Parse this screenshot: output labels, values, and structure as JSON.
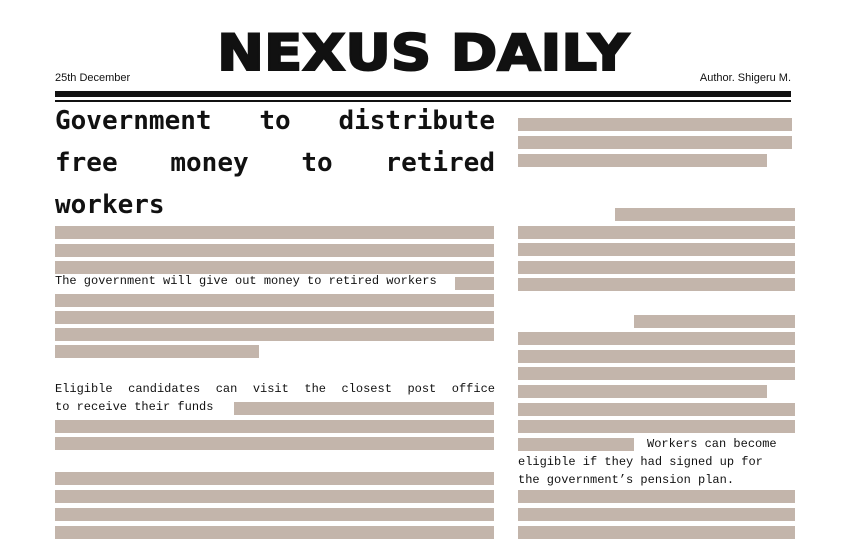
{
  "masthead": {
    "title": "NEXUS DAILY"
  },
  "meta": {
    "date": "25th December",
    "author": "Author. Shigeru M."
  },
  "article": {
    "headline": "Government to distribute free money to retired workers",
    "lead": "The government will give out money to retired workers",
    "eligible_line1": "Eligible candidates can visit the closest post office",
    "eligible_line2": "to receive their funds",
    "workers_line1": "Workers can become",
    "workers_line2": "eligible if they had signed up for",
    "workers_line3": "the government’s pension plan."
  },
  "colors": {
    "placeholder": "#c3b5ab",
    "ink": "#111111"
  }
}
